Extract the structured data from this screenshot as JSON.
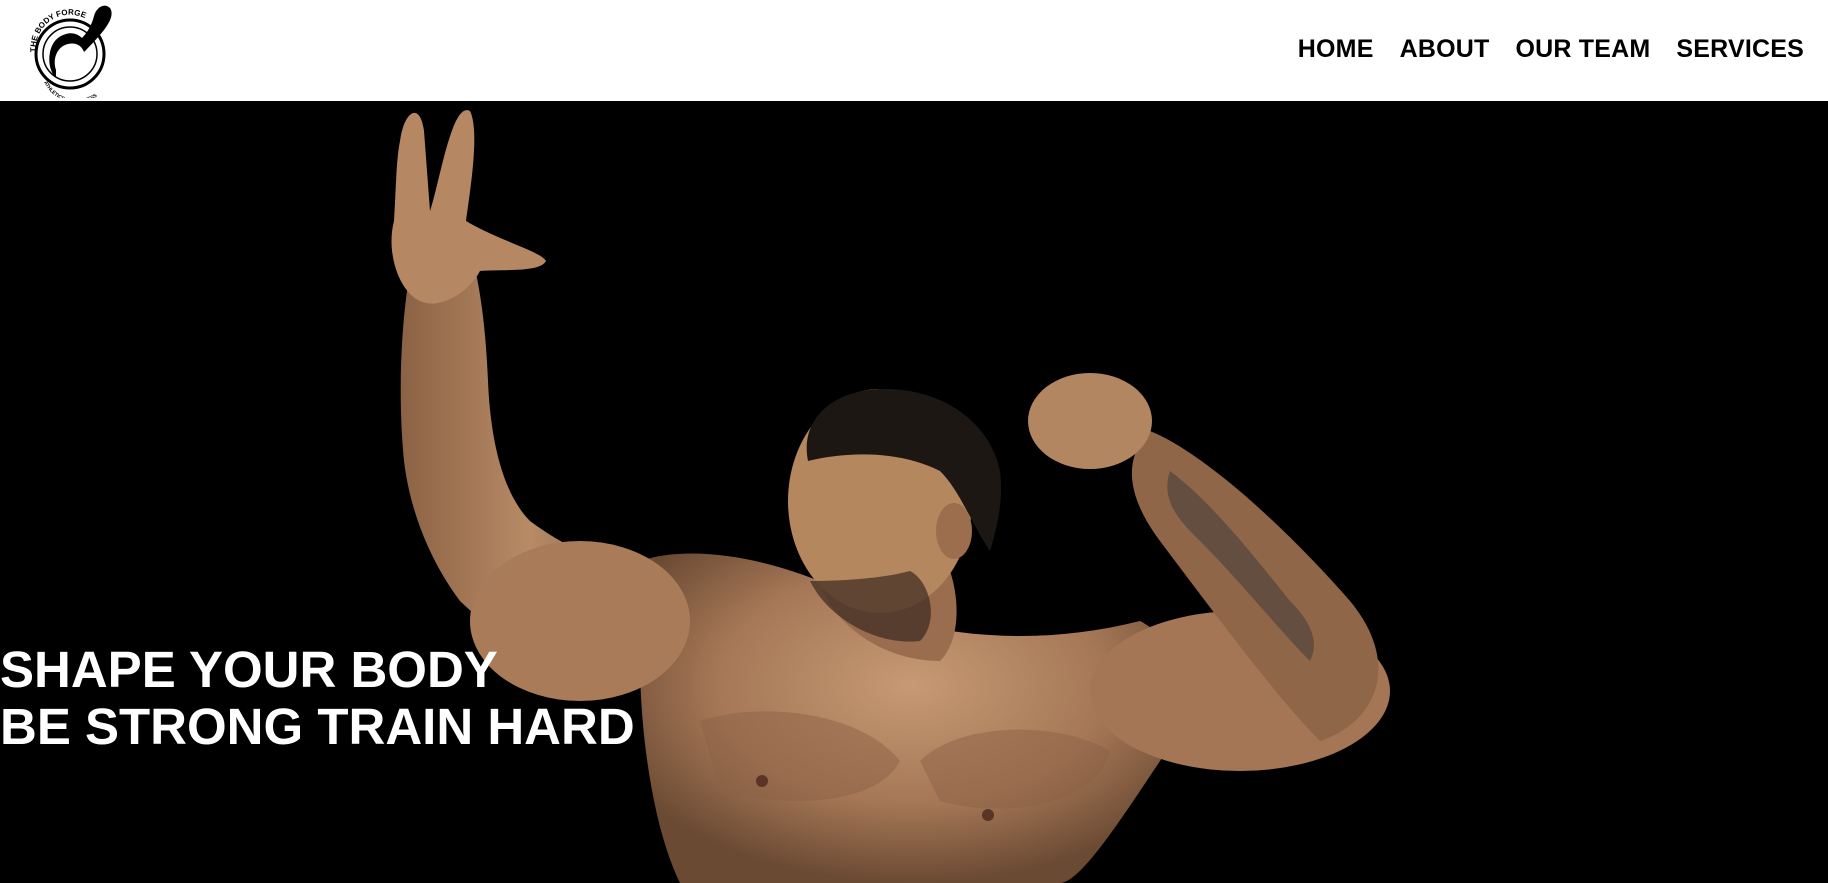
{
  "logo": {
    "icon": "bodybuilder-emblem-icon",
    "text_top": "THE BODY FORGE",
    "text_bottom": "ATHLETICS AND FITNESS"
  },
  "nav": {
    "items": [
      {
        "label": "HOME"
      },
      {
        "label": "ABOUT"
      },
      {
        "label": "OUR TEAM"
      },
      {
        "label": "SERVICES"
      }
    ]
  },
  "hero": {
    "line1": "SHAPE YOUR BODY",
    "line2": "BE STRONG TRAIN HARD",
    "background_color": "#000000",
    "skin_color": "#b0835f"
  }
}
